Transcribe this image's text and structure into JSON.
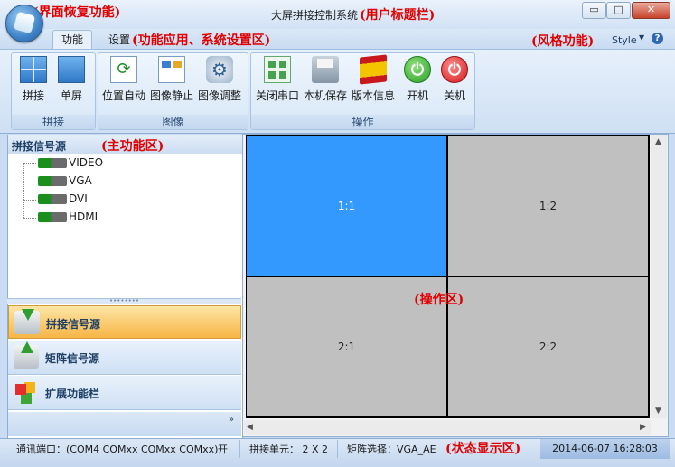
{
  "window": {
    "title": "大屏拼接控制系统",
    "title_annotation": "(用户标题栏)",
    "orb_annotation": "(界面恢复功能)",
    "min_icon": "▭",
    "max_icon": "□",
    "close_icon": "✕"
  },
  "tabs": {
    "function": "功能",
    "settings": "设置",
    "settings_annotation": "(功能应用、系统设置区)",
    "style_annotation": "(风格功能)",
    "style_label": "Style",
    "help": "?"
  },
  "ribbon": {
    "groups": [
      {
        "label": "拼接",
        "buttons": [
          "拼接",
          "单屏"
        ]
      },
      {
        "label": "图像",
        "buttons": [
          "位置自动",
          "图像静止",
          "图像调整"
        ]
      },
      {
        "label": "操作",
        "buttons": [
          "关闭串口",
          "本机保存",
          "版本信息",
          "开机",
          "关机"
        ]
      }
    ]
  },
  "left_panel": {
    "title": "拼接信号源",
    "annotation": "(主功能区)",
    "sources": [
      "VIDEO",
      "VGA",
      "DVI",
      "HDMI"
    ],
    "nav": [
      {
        "label": "拼接信号源",
        "icon": "download-icon",
        "active": true
      },
      {
        "label": "矩阵信号源",
        "icon": "upload-icon",
        "active": false
      },
      {
        "label": "扩展功能栏",
        "icon": "cubes-icon",
        "active": false
      }
    ],
    "more": "»"
  },
  "operation": {
    "annotation": "(操作区)",
    "cells": [
      "1:1",
      "1:2",
      "2:1",
      "2:2"
    ],
    "selected": "1:1",
    "colors": {
      "selected": "#3399ff",
      "normal": "#c0c0c0"
    }
  },
  "status": {
    "port_label": "通讯端口：(COM4 COMxx COMxx COMxx)",
    "port_state": "开",
    "unit": "拼接单元： 2 X 2",
    "matrix": "矩阵选择：VGA_AE",
    "annotation": "(状态显示区)",
    "datetime": "2014-06-07 16:28:03"
  }
}
